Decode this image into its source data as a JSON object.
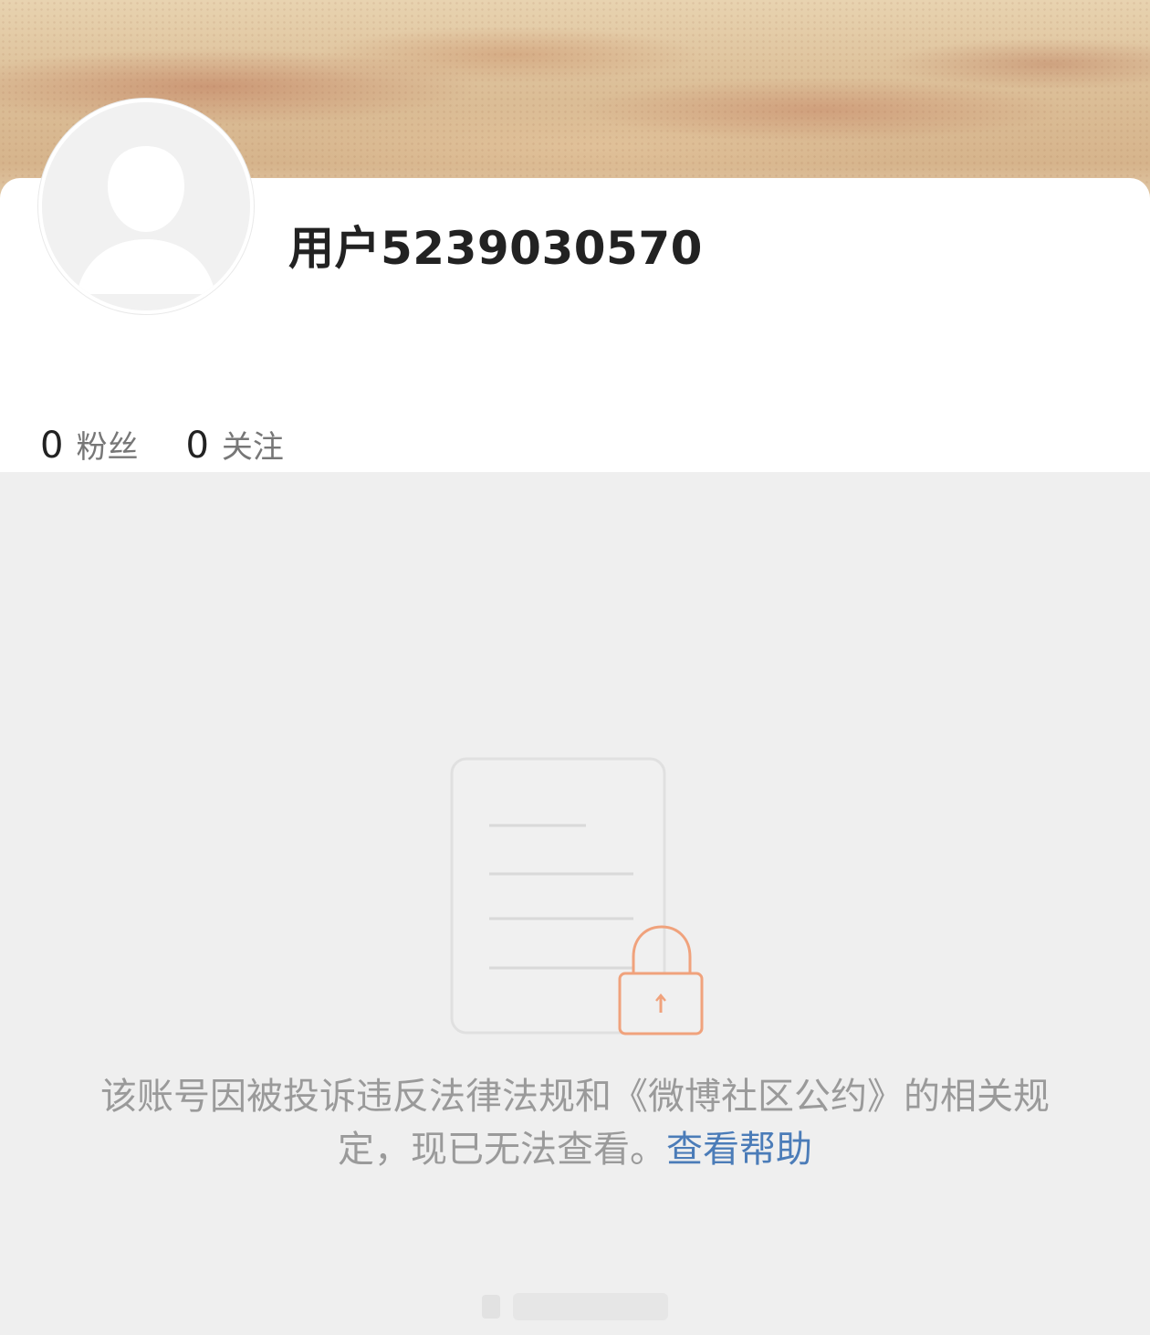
{
  "profile": {
    "username": "用户5239030570",
    "stats": [
      {
        "count": "0",
        "label": "粉丝"
      },
      {
        "count": "0",
        "label": "关注"
      }
    ]
  },
  "notice": {
    "message": "该账号因被投诉违反法律法规和《微博社区公约》的相关规定，现已无法查看。",
    "help_link": "查看帮助"
  },
  "icons": {
    "avatar": "default-user-avatar",
    "illustration": "locked-document-icon",
    "lock": "lock-icon"
  },
  "colors": {
    "link": "#4b7cb8",
    "lock": "#f0a27c",
    "muted_text": "#9a9a9a",
    "page_bg": "#efefef"
  }
}
